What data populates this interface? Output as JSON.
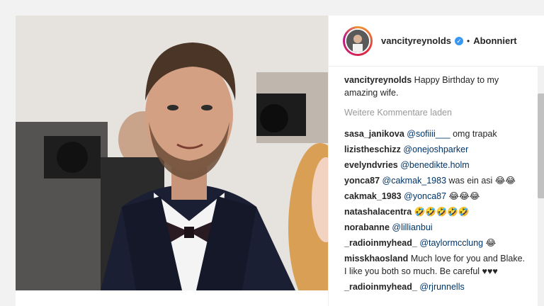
{
  "post": {
    "username": "vancityreynolds",
    "follow_status": "Abonniert",
    "separator": "•",
    "verified_mark": "✓"
  },
  "caption": {
    "user": "vancityreynolds",
    "text": "Happy Birthday to my amazing wife."
  },
  "load_more": "Weitere Kommentare laden",
  "comments": [
    {
      "user": "sasa_janikova",
      "mention": "@sofiiii___",
      "text": " omg trapak"
    },
    {
      "user": "lizistheschizz",
      "mention": "@onejoshparker",
      "text": ""
    },
    {
      "user": "evelyndvries",
      "mention": "@benedikte.holm",
      "text": ""
    },
    {
      "user": "yonca87",
      "mention": "@cakmak_1983",
      "text": " was ein asi 😂😂"
    },
    {
      "user": "cakmak_1983",
      "mention": "@yonca87",
      "text": " 😂😂😂"
    },
    {
      "user": "natashalacentra",
      "mention": "",
      "text": "🤣🤣🤣🤣🤣"
    },
    {
      "user": "norabanne",
      "mention": "@lillianbui",
      "text": ""
    },
    {
      "user": "_radioinmyhead_",
      "mention": "@taylormcclung",
      "text": " 😂"
    },
    {
      "user": "misskhaosland",
      "mention": "",
      "text": "Much love for you and Blake. I like you both so much. Be careful ♥♥♥"
    },
    {
      "user": "_radioinmyhead_",
      "mention": "@rjrunnells",
      "text": ""
    }
  ]
}
